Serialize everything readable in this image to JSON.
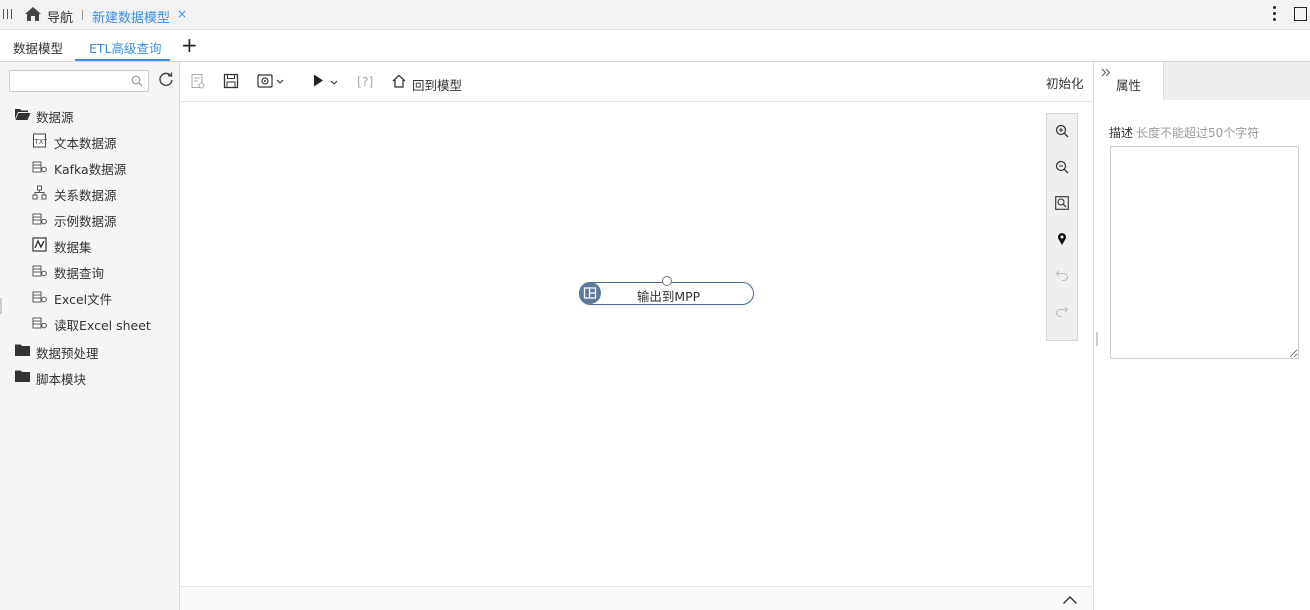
{
  "topbar": {
    "nav_label": "导航",
    "active_tab": "新建数据模型",
    "close_glyph": "×"
  },
  "subtabs": {
    "items": [
      "数据模型",
      "ETL高级查询"
    ],
    "active_index": 1,
    "add_glyph": "+"
  },
  "left": {
    "search": {
      "value": "",
      "placeholder": ""
    },
    "tree": [
      {
        "label": "数据源",
        "icon": "folder-open-icon",
        "level": 0,
        "children": [
          {
            "label": "文本数据源",
            "icon": "text-file-icon"
          },
          {
            "label": "Kafka数据源",
            "icon": "datasource-icon"
          },
          {
            "label": "关系数据源",
            "icon": "relation-icon"
          },
          {
            "label": "示例数据源",
            "icon": "datasource-icon"
          },
          {
            "label": "数据集",
            "icon": "dataset-icon"
          },
          {
            "label": "数据查询",
            "icon": "datasource-icon"
          },
          {
            "label": "Excel文件",
            "icon": "datasource-icon"
          },
          {
            "label": "读取Excel sheet",
            "icon": "datasource-icon"
          }
        ]
      },
      {
        "label": "数据预处理",
        "icon": "folder-icon",
        "level": 0
      },
      {
        "label": "脚本模块",
        "icon": "folder-icon",
        "level": 0
      }
    ]
  },
  "toolbar": {
    "help_label": "[?]",
    "back_to_model": "回到模型",
    "init_label": "初始化"
  },
  "canvas": {
    "node_label": "输出到MPP"
  },
  "right": {
    "tab_label": "属性",
    "desc_label": "描述",
    "desc_hint": "长度不能超过50个字符",
    "desc_value": ""
  }
}
